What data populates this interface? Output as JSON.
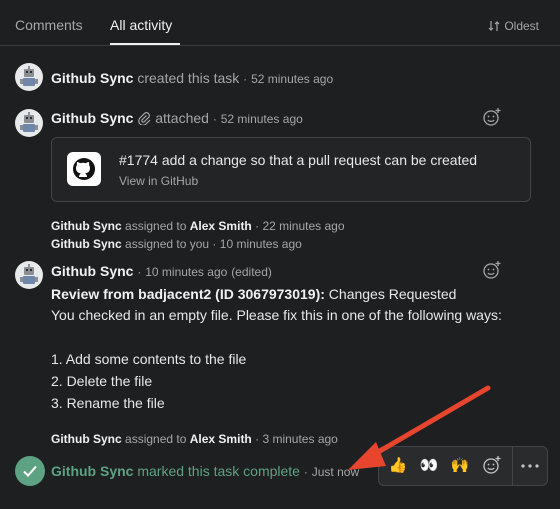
{
  "tabs": [
    "Comments",
    "All activity"
  ],
  "sort_label": "Oldest",
  "events": [
    {
      "actor": "Github Sync",
      "action": "created this task",
      "time": "52 minutes ago"
    },
    {
      "actor": "Github Sync",
      "action": "attached",
      "time": "52 minutes ago"
    },
    {
      "actor": "Github Sync",
      "action": "assigned to",
      "target": "Alex Smith",
      "time": "22 minutes ago"
    },
    {
      "actor": "Github Sync",
      "action": "assigned to you",
      "time": "10 minutes ago"
    },
    {
      "actor": "Github Sync",
      "time": "10 minutes ago",
      "edited": "(edited)"
    },
    {
      "actor": "Github Sync",
      "action": "assigned to",
      "target": "Alex Smith",
      "time": "3 minutes ago"
    },
    {
      "actor": "Github Sync",
      "action": "marked this task complete",
      "time": "Just now"
    }
  ],
  "attachment": {
    "title": "#1774 add a change so that a pull request can be created",
    "link": "View in GitHub",
    "icon": "github-icon"
  },
  "comment": {
    "review_bold": "Review from badjacent2 (ID 3067973019):",
    "review_rest": " Changes Requested",
    "line2": "You checked in an empty file. Please fix this in one of the following ways:",
    "items": [
      "1. Add some contents to the file",
      "2. Delete the file",
      "3. Rename the file"
    ]
  },
  "reactions": [
    "👍",
    "👀",
    "🙌"
  ],
  "separator": "·",
  "colors": {
    "accent_green": "#5da283",
    "arrow_red": "#e8452f"
  }
}
